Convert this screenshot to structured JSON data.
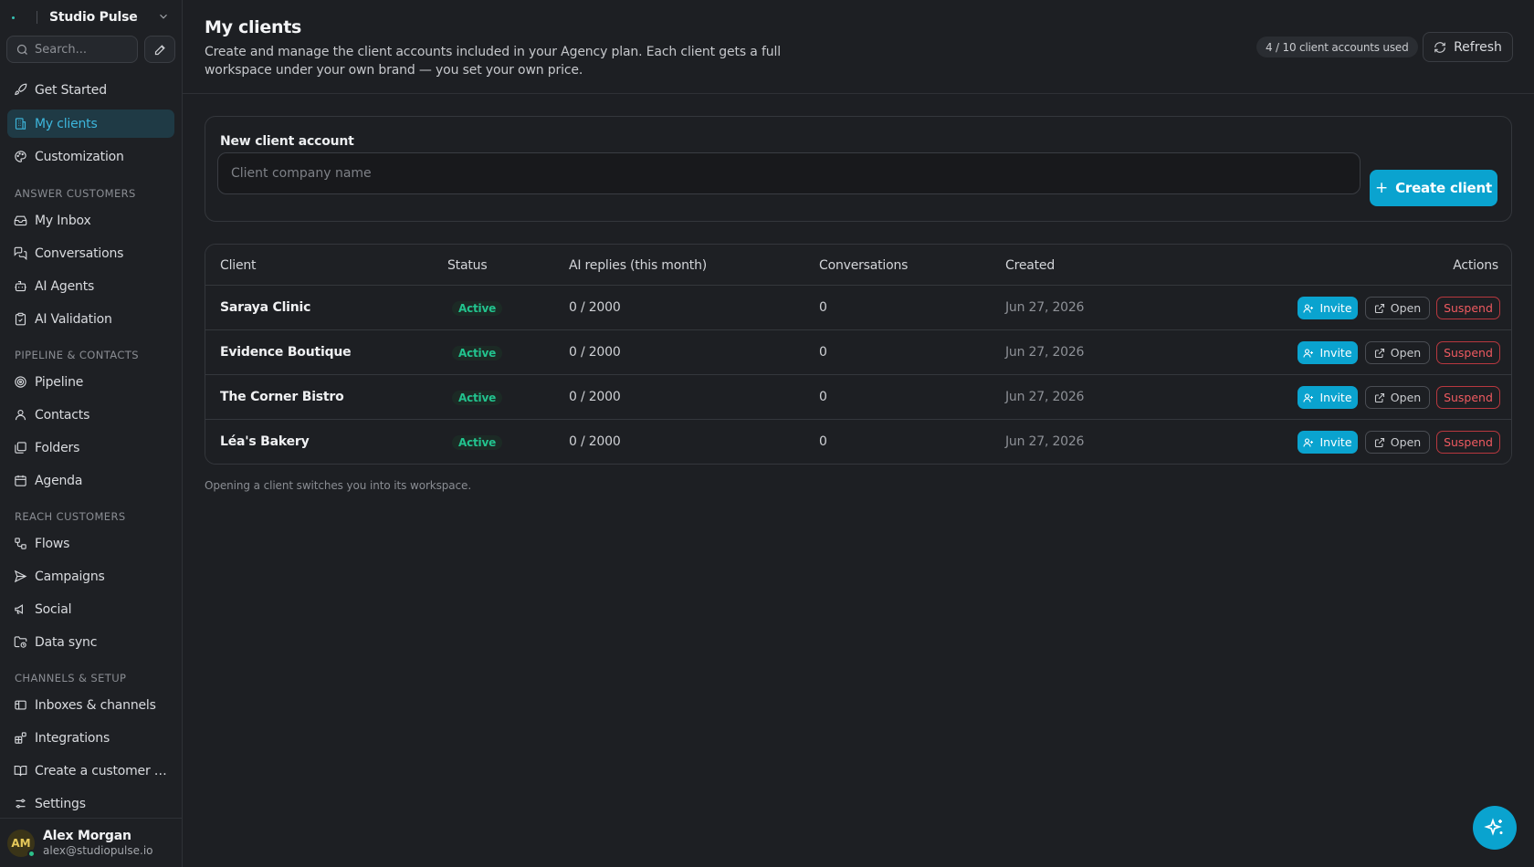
{
  "workspace": {
    "name": "Studio Pulse"
  },
  "search": {
    "placeholder": "Search..."
  },
  "sidebar": {
    "top_items": [
      {
        "label": "Get Started",
        "icon": "rocket-icon"
      },
      {
        "label": "My clients",
        "icon": "building-icon",
        "active": true
      },
      {
        "label": "Customization",
        "icon": "palette-icon"
      }
    ],
    "sections": [
      {
        "title": "ANSWER CUSTOMERS",
        "items": [
          {
            "label": "My Inbox",
            "icon": "inbox-icon"
          },
          {
            "label": "Conversations",
            "icon": "chat-icon"
          },
          {
            "label": "AI Agents",
            "icon": "bot-icon"
          },
          {
            "label": "AI Validation",
            "icon": "clipboard-check-icon"
          }
        ]
      },
      {
        "title": "PIPELINE & CONTACTS",
        "items": [
          {
            "label": "Pipeline",
            "icon": "target-icon"
          },
          {
            "label": "Contacts",
            "icon": "user-icon"
          },
          {
            "label": "Folders",
            "icon": "folders-icon"
          },
          {
            "label": "Agenda",
            "icon": "calendar-icon"
          }
        ]
      },
      {
        "title": "REACH CUSTOMERS",
        "items": [
          {
            "label": "Flows",
            "icon": "workflow-icon"
          },
          {
            "label": "Campaigns",
            "icon": "send-icon"
          },
          {
            "label": "Social",
            "icon": "megaphone-icon"
          },
          {
            "label": "Data sync",
            "icon": "folder-sync-icon"
          }
        ]
      },
      {
        "title": "CHANNELS & SETUP",
        "items": [
          {
            "label": "Inboxes & channels",
            "icon": "channels-icon"
          },
          {
            "label": "Integrations",
            "icon": "blocks-icon"
          },
          {
            "label": "Create a customer portal",
            "icon": "book-icon"
          },
          {
            "label": "Settings",
            "icon": "sliders-icon"
          }
        ]
      }
    ]
  },
  "user": {
    "initials": "AM",
    "name": "Alex Morgan",
    "email": "alex@studiopulse.io"
  },
  "header": {
    "title": "My clients",
    "description": "Create and manage the client accounts included in your Agency plan. Each client gets a full workspace under your own brand — you set your own price.",
    "usage_badge": "4 / 10 client accounts used",
    "refresh_label": "Refresh"
  },
  "create": {
    "label": "New client account",
    "placeholder": "Client company name",
    "button_label": "Create client"
  },
  "table": {
    "columns": [
      "Client",
      "Status",
      "AI replies (this month)",
      "Conversations",
      "Created",
      "Actions"
    ],
    "rows": [
      {
        "client": "Saraya Clinic",
        "status": "Active",
        "replies": "0 / 2000",
        "conversations": "0",
        "created": "Jun 27, 2026"
      },
      {
        "client": "Evidence Boutique",
        "status": "Active",
        "replies": "0 / 2000",
        "conversations": "0",
        "created": "Jun 27, 2026"
      },
      {
        "client": "The Corner Bistro",
        "status": "Active",
        "replies": "0 / 2000",
        "conversations": "0",
        "created": "Jun 27, 2026"
      },
      {
        "client": "Léa's Bakery",
        "status": "Active",
        "replies": "0 / 2000",
        "conversations": "0",
        "created": "Jun 27, 2026"
      }
    ],
    "actions": {
      "invite": "Invite",
      "open": "Open",
      "suspend": "Suspend"
    }
  },
  "footnote": "Opening a client switches you into its workspace.",
  "colors": {
    "accent": "#0aa3cf",
    "active_status": "#22c38e",
    "danger": "#ef5a60",
    "background": "#1d1f23"
  }
}
